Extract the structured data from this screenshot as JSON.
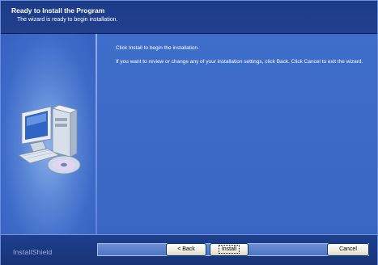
{
  "header": {
    "title": "Ready to Install the Program",
    "subtitle": "The wizard is ready to begin installation."
  },
  "content": {
    "instruction": "Click Install to begin the installation.",
    "review_text": "If you want to review or change any of your installation settings, click Back. Click Cancel to exit the wizard."
  },
  "footer": {
    "brand": "InstallShield",
    "back_label": "< Back",
    "install_label": "Install",
    "cancel_label": "Cancel"
  },
  "icons": {
    "illustration": "computer-with-cd-icon"
  },
  "colors": {
    "header_bg": "#1d3c88",
    "content_bg": "#3f6dca",
    "footer_bg": "#1e3f8d",
    "text": "#ffffff"
  }
}
